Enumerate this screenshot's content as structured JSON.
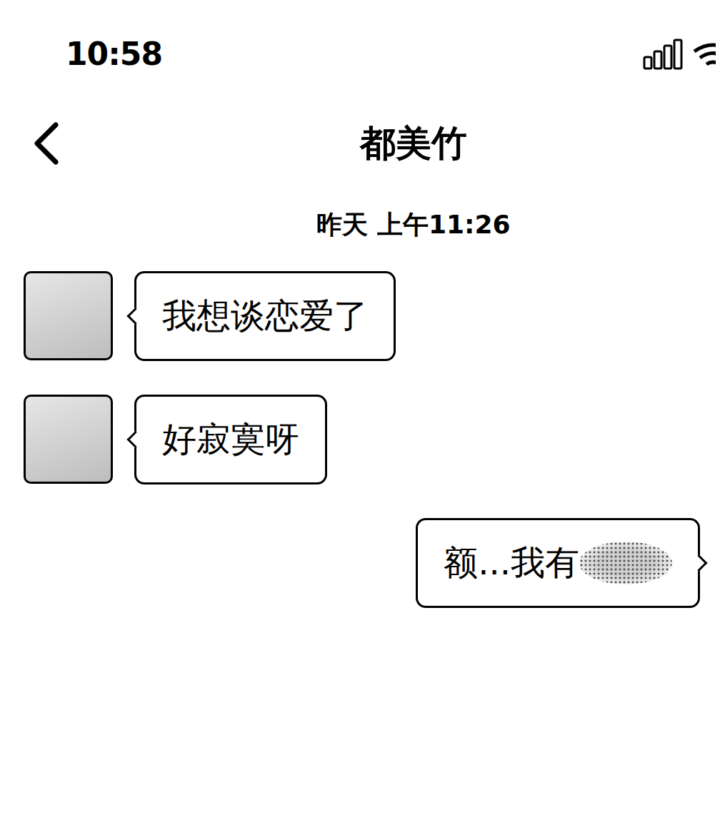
{
  "status_bar": {
    "time": "10:58"
  },
  "header": {
    "title": "都美竹"
  },
  "timestamp": "昨天 上午11:26",
  "messages": [
    {
      "kind": "incoming",
      "text": "我想谈恋爱了",
      "redacted": false
    },
    {
      "kind": "incoming",
      "text": "好寂寞呀",
      "redacted": false
    },
    {
      "kind": "outgoing",
      "text": "额...我有",
      "redacted": true
    }
  ]
}
